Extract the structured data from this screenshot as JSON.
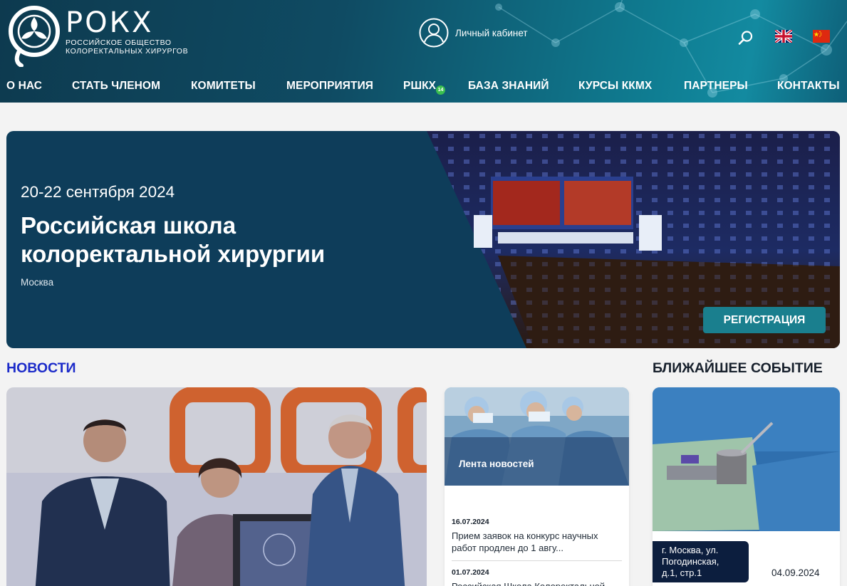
{
  "brand": {
    "name": "РОКХ",
    "subtitle_line1": "РОССИЙСКОЕ ОБЩЕСТВО",
    "subtitle_line2": "КОЛОРЕКТАЛЬНЫХ ХИРУРГОВ"
  },
  "header": {
    "account_label": "Личный кабинет",
    "icons": [
      "user-icon",
      "search-icon",
      "uk-flag-icon",
      "china-flag-icon"
    ]
  },
  "nav": {
    "items": [
      {
        "label": "О НАС"
      },
      {
        "label": "СТАТЬ ЧЛЕНОМ"
      },
      {
        "label": "КОМИТЕТЫ"
      },
      {
        "label": "МЕРОПРИЯТИЯ"
      },
      {
        "label": "РШКХ"
      },
      {
        "label": "БАЗА ЗНАНИЙ"
      },
      {
        "label": "КУРСЫ ККМХ"
      },
      {
        "label": "ПАРТНЕРЫ"
      },
      {
        "label": "КОНТАКТЫ"
      }
    ],
    "badge": "14"
  },
  "hero": {
    "date": "20-22 сентября 2024",
    "title_line1": "Российская школа",
    "title_line2": "колоректальной хирургии",
    "city": "Москва",
    "button_label": "РЕГИСТРАЦИЯ"
  },
  "news": {
    "section_title": "НОВОСТИ",
    "feed_label": "Лента новостей",
    "feed_items": [
      {
        "date": "16.07.2024",
        "text": "Прием заявок на конкурс научных работ продлен до 1 авгу..."
      },
      {
        "date": "01.07.2024",
        "text": "Российская Школа Колоректальной"
      }
    ]
  },
  "event": {
    "section_title": "БЛИЖАЙШЕЕ СОБЫТИЕ",
    "address_line1": "г. Москва, ул.",
    "address_line2": "Погодинская,",
    "address_line3": "д.1, стр.1",
    "date": "04.09.2024"
  },
  "colors": {
    "header_dark": "#0d3a4f",
    "header_teal": "#138aa0",
    "news_title": "#1c2bc9",
    "hero_panel": "#0e3d5a",
    "button": "#1a7f8e",
    "badge": "#3bbf4f",
    "event_address_bg": "#0c1e3e"
  }
}
